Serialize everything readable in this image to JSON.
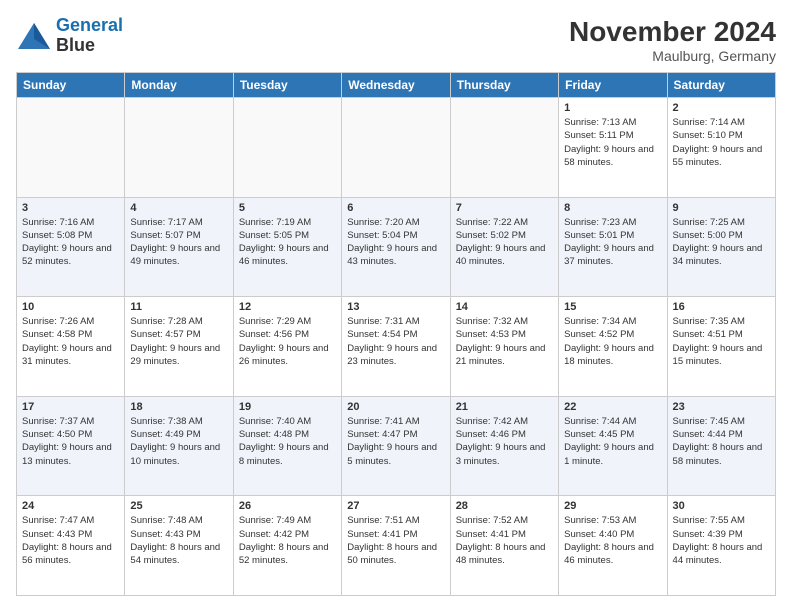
{
  "header": {
    "logo_line1": "General",
    "logo_line2": "Blue",
    "title": "November 2024",
    "location": "Maulburg, Germany"
  },
  "weekdays": [
    "Sunday",
    "Monday",
    "Tuesday",
    "Wednesday",
    "Thursday",
    "Friday",
    "Saturday"
  ],
  "weeks": [
    [
      {
        "day": "",
        "info": ""
      },
      {
        "day": "",
        "info": ""
      },
      {
        "day": "",
        "info": ""
      },
      {
        "day": "",
        "info": ""
      },
      {
        "day": "",
        "info": ""
      },
      {
        "day": "1",
        "info": "Sunrise: 7:13 AM\nSunset: 5:11 PM\nDaylight: 9 hours and 58 minutes."
      },
      {
        "day": "2",
        "info": "Sunrise: 7:14 AM\nSunset: 5:10 PM\nDaylight: 9 hours and 55 minutes."
      }
    ],
    [
      {
        "day": "3",
        "info": "Sunrise: 7:16 AM\nSunset: 5:08 PM\nDaylight: 9 hours and 52 minutes."
      },
      {
        "day": "4",
        "info": "Sunrise: 7:17 AM\nSunset: 5:07 PM\nDaylight: 9 hours and 49 minutes."
      },
      {
        "day": "5",
        "info": "Sunrise: 7:19 AM\nSunset: 5:05 PM\nDaylight: 9 hours and 46 minutes."
      },
      {
        "day": "6",
        "info": "Sunrise: 7:20 AM\nSunset: 5:04 PM\nDaylight: 9 hours and 43 minutes."
      },
      {
        "day": "7",
        "info": "Sunrise: 7:22 AM\nSunset: 5:02 PM\nDaylight: 9 hours and 40 minutes."
      },
      {
        "day": "8",
        "info": "Sunrise: 7:23 AM\nSunset: 5:01 PM\nDaylight: 9 hours and 37 minutes."
      },
      {
        "day": "9",
        "info": "Sunrise: 7:25 AM\nSunset: 5:00 PM\nDaylight: 9 hours and 34 minutes."
      }
    ],
    [
      {
        "day": "10",
        "info": "Sunrise: 7:26 AM\nSunset: 4:58 PM\nDaylight: 9 hours and 31 minutes."
      },
      {
        "day": "11",
        "info": "Sunrise: 7:28 AM\nSunset: 4:57 PM\nDaylight: 9 hours and 29 minutes."
      },
      {
        "day": "12",
        "info": "Sunrise: 7:29 AM\nSunset: 4:56 PM\nDaylight: 9 hours and 26 minutes."
      },
      {
        "day": "13",
        "info": "Sunrise: 7:31 AM\nSunset: 4:54 PM\nDaylight: 9 hours and 23 minutes."
      },
      {
        "day": "14",
        "info": "Sunrise: 7:32 AM\nSunset: 4:53 PM\nDaylight: 9 hours and 21 minutes."
      },
      {
        "day": "15",
        "info": "Sunrise: 7:34 AM\nSunset: 4:52 PM\nDaylight: 9 hours and 18 minutes."
      },
      {
        "day": "16",
        "info": "Sunrise: 7:35 AM\nSunset: 4:51 PM\nDaylight: 9 hours and 15 minutes."
      }
    ],
    [
      {
        "day": "17",
        "info": "Sunrise: 7:37 AM\nSunset: 4:50 PM\nDaylight: 9 hours and 13 minutes."
      },
      {
        "day": "18",
        "info": "Sunrise: 7:38 AM\nSunset: 4:49 PM\nDaylight: 9 hours and 10 minutes."
      },
      {
        "day": "19",
        "info": "Sunrise: 7:40 AM\nSunset: 4:48 PM\nDaylight: 9 hours and 8 minutes."
      },
      {
        "day": "20",
        "info": "Sunrise: 7:41 AM\nSunset: 4:47 PM\nDaylight: 9 hours and 5 minutes."
      },
      {
        "day": "21",
        "info": "Sunrise: 7:42 AM\nSunset: 4:46 PM\nDaylight: 9 hours and 3 minutes."
      },
      {
        "day": "22",
        "info": "Sunrise: 7:44 AM\nSunset: 4:45 PM\nDaylight: 9 hours and 1 minute."
      },
      {
        "day": "23",
        "info": "Sunrise: 7:45 AM\nSunset: 4:44 PM\nDaylight: 8 hours and 58 minutes."
      }
    ],
    [
      {
        "day": "24",
        "info": "Sunrise: 7:47 AM\nSunset: 4:43 PM\nDaylight: 8 hours and 56 minutes."
      },
      {
        "day": "25",
        "info": "Sunrise: 7:48 AM\nSunset: 4:43 PM\nDaylight: 8 hours and 54 minutes."
      },
      {
        "day": "26",
        "info": "Sunrise: 7:49 AM\nSunset: 4:42 PM\nDaylight: 8 hours and 52 minutes."
      },
      {
        "day": "27",
        "info": "Sunrise: 7:51 AM\nSunset: 4:41 PM\nDaylight: 8 hours and 50 minutes."
      },
      {
        "day": "28",
        "info": "Sunrise: 7:52 AM\nSunset: 4:41 PM\nDaylight: 8 hours and 48 minutes."
      },
      {
        "day": "29",
        "info": "Sunrise: 7:53 AM\nSunset: 4:40 PM\nDaylight: 8 hours and 46 minutes."
      },
      {
        "day": "30",
        "info": "Sunrise: 7:55 AM\nSunset: 4:39 PM\nDaylight: 8 hours and 44 minutes."
      }
    ]
  ]
}
